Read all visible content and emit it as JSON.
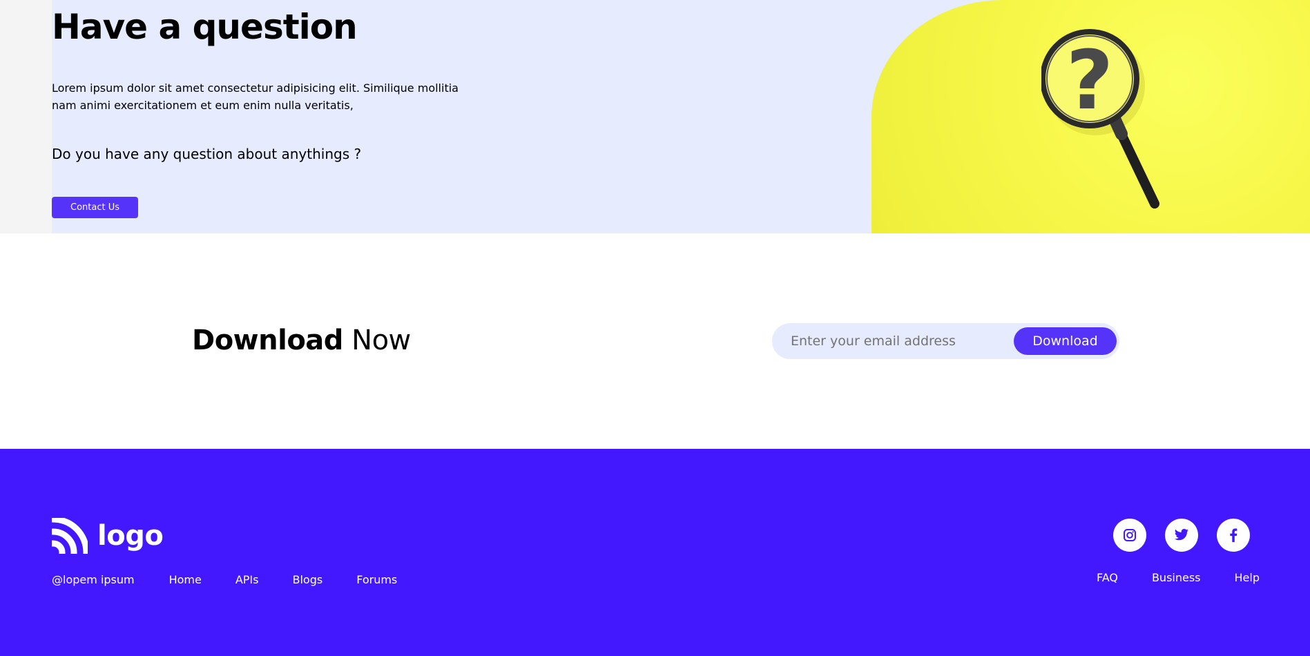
{
  "hero": {
    "title": "Have a question",
    "description": "Lorem ipsum dolor sit amet consectetur adipisicing elit. Similique mollitia nam animi exercitationem et eum enim nulla veritatis,",
    "question": "Do you have any question about anythings ?",
    "contact_label": "Contact Us",
    "image_icon": "magnifying-glass-question-mark"
  },
  "download": {
    "title_bold": "Download",
    "title_rest": "Now",
    "email_placeholder": "Enter your email address",
    "button_label": "Download"
  },
  "footer": {
    "logo_text": "logo",
    "logo_icon": "signal-arcs-logo",
    "copyright": "@lopem ipsum",
    "nav_links": [
      {
        "label": "Home"
      },
      {
        "label": "APIs"
      },
      {
        "label": "Blogs"
      },
      {
        "label": "Forums"
      }
    ],
    "social": [
      {
        "name": "instagram",
        "icon": "instagram-icon"
      },
      {
        "name": "twitter",
        "icon": "twitter-icon"
      },
      {
        "name": "facebook",
        "icon": "facebook-icon"
      }
    ],
    "help_links": [
      {
        "label": "FAQ"
      },
      {
        "label": "Business"
      },
      {
        "label": "Help"
      }
    ]
  },
  "colors": {
    "accent": "#5533f8",
    "footer_bg": "#4318ff",
    "hero_bg": "#e6ebfd",
    "hero_image_bg": "#f7f74a"
  }
}
